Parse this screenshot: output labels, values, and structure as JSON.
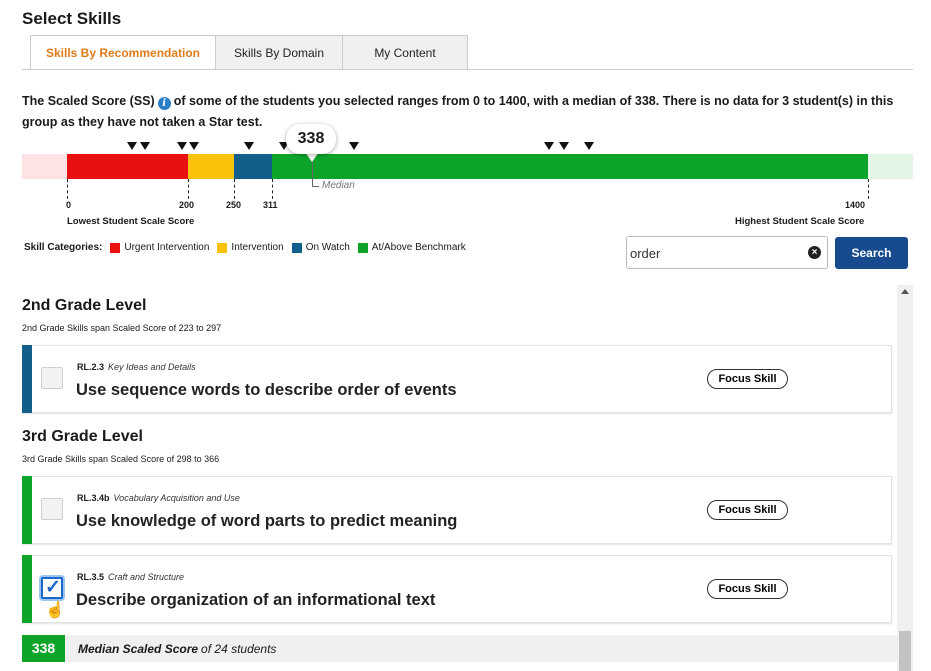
{
  "page": {
    "title": "Select Skills"
  },
  "tabs": [
    {
      "label": "Skills By Recommendation",
      "active": true
    },
    {
      "label": "Skills By Domain",
      "active": false
    },
    {
      "label": "My Content",
      "active": false
    }
  ],
  "summary": {
    "prefix": "The Scaled Score (SS)",
    "text": "of some of the students you selected ranges from 0 to 1400, with a median of 338. There is no data for 3 student(s) in this group as they have not taken a Star test."
  },
  "scale": {
    "min": 0,
    "max": 1400,
    "median": 338,
    "median_bubble": "338",
    "median_label": "Median",
    "segments": [
      {
        "category": "Urgent Intervention",
        "from": 0,
        "to": 200,
        "color": "#e8110f"
      },
      {
        "category": "Intervention",
        "from": 200,
        "to": 250,
        "color": "#fac20a"
      },
      {
        "category": "On Watch",
        "from": 250,
        "to": 311,
        "color": "#125f8c"
      },
      {
        "category": "At/Above Benchmark",
        "from": 311,
        "to": 1400,
        "color": "#0ca52a"
      }
    ],
    "tick_labels": {
      "t0": "0",
      "t200": "200",
      "t250": "250",
      "t311": "311",
      "t1400": "1400"
    },
    "student_markers": [
      118,
      131,
      168,
      180,
      235,
      270,
      285,
      340,
      535,
      550,
      575
    ],
    "lowest_label": "Lowest Student Scale Score",
    "highest_label": "Highest Student Scale Score"
  },
  "legend": {
    "title": "Skill Categories:",
    "items": [
      {
        "label": "Urgent Intervention",
        "color": "#e8110f"
      },
      {
        "label": "Intervention",
        "color": "#fac20a"
      },
      {
        "label": "On Watch",
        "color": "#125f8c"
      },
      {
        "label": "At/Above Benchmark",
        "color": "#0ca52a"
      }
    ]
  },
  "search": {
    "value": "order",
    "button_label": "Search"
  },
  "grades": [
    {
      "title": "2nd Grade Level",
      "subtitle": "2nd Grade Skills span Scaled Score of 223 to 297",
      "skills": [
        {
          "code": "RL.2.3",
          "domain": "Key Ideas and Details",
          "name": "Use sequence words to describe order of events",
          "focus_label": "Focus Skill",
          "checked": false,
          "color": "#125f8c"
        }
      ]
    },
    {
      "title": "3rd Grade Level",
      "subtitle": "3rd Grade Skills span Scaled Score of 298 to 366",
      "skills": [
        {
          "code": "RL.3.4b",
          "domain": "Vocabulary Acquisition and Use",
          "name": "Use knowledge of word parts to predict meaning",
          "focus_label": "Focus Skill",
          "checked": false,
          "color": "#0ca52a"
        },
        {
          "code": "RL.3.5",
          "domain": "Craft and Structure",
          "name": "Describe organization of an informational text",
          "focus_label": "Focus Skill",
          "checked": true,
          "color": "#0ca52a"
        }
      ]
    }
  ],
  "median_footer": {
    "score": "338",
    "label": "Median Scaled Score",
    "suffix": "of 24 students"
  }
}
